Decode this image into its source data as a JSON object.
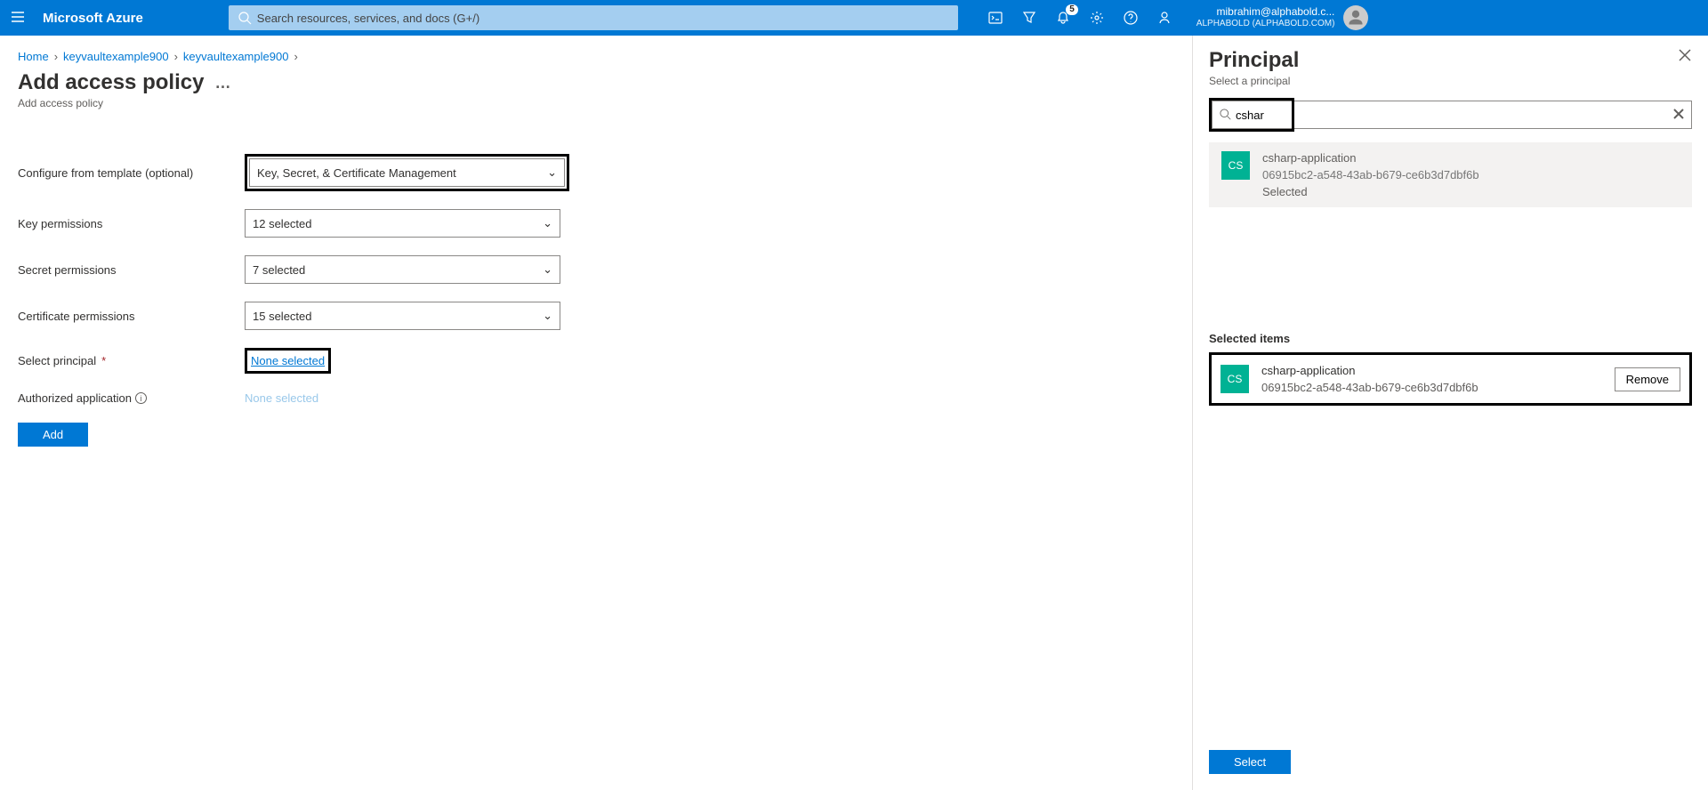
{
  "header": {
    "brand": "Microsoft Azure",
    "search_placeholder": "Search resources, services, and docs (G+/)",
    "notification_count": "5",
    "user_email": "mibrahim@alphabold.c...",
    "user_tenant": "ALPHABOLD (ALPHABOLD.COM)"
  },
  "breadcrumbs": {
    "items": [
      {
        "label": "Home"
      },
      {
        "label": "keyvaultexample900"
      },
      {
        "label": "keyvaultexample900"
      }
    ]
  },
  "page": {
    "title": "Add access policy",
    "subtitle": "Add access policy",
    "ellipsis": "…"
  },
  "form": {
    "template_label": "Configure from template (optional)",
    "template_value": "Key, Secret, & Certificate Management",
    "key_label": "Key permissions",
    "key_value": "12 selected",
    "secret_label": "Secret permissions",
    "secret_value": "7 selected",
    "cert_label": "Certificate permissions",
    "cert_value": "15 selected",
    "principal_label": "Select principal",
    "principal_value": "None selected",
    "auth_app_label": "Authorized application",
    "auth_app_value": "None selected",
    "add_button": "Add"
  },
  "panel": {
    "title": "Principal",
    "subtitle": "Select a principal",
    "search_value": "cshar",
    "select_button": "Select"
  },
  "result": {
    "initials": "CS",
    "name": "csharp-application",
    "id": "06915bc2-a548-43ab-b679-ce6b3d7dbf6b",
    "status": "Selected"
  },
  "selected": {
    "header": "Selected items",
    "initials": "CS",
    "name": "csharp-application",
    "id": "06915bc2-a548-43ab-b679-ce6b3d7dbf6b",
    "remove_label": "Remove"
  }
}
